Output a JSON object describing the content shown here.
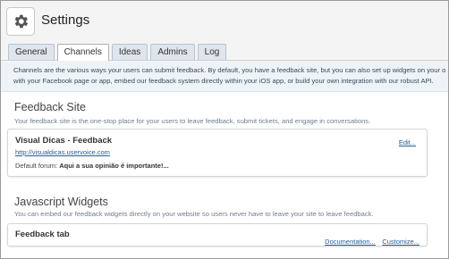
{
  "header": {
    "title": "Settings",
    "icon": "gear-icon"
  },
  "tabs": [
    {
      "label": "General",
      "active": false
    },
    {
      "label": "Channels",
      "active": true
    },
    {
      "label": "Ideas",
      "active": false
    },
    {
      "label": "Admins",
      "active": false
    },
    {
      "label": "Log",
      "active": false
    }
  ],
  "intro": {
    "line1": "Channels are the various ways your users can submit feedback. By default, you have a feedback site, but you can also set up widgets on your o",
    "line2": "with your Facebook page or app, embed our feedback system directly within your iOS app, or build your own integration with our robust API."
  },
  "feedback_site": {
    "title": "Feedback Site",
    "description": "Your feedback site is the one-stop place for your users to leave feedback, submit tickets, and engage in conversations.",
    "card": {
      "name": "Visual Dicas - Feedback",
      "url": "http://visualdicas.uservoice.com",
      "forum_label": "Default forum:",
      "forum_value": "Aqui a sua opinião é importante!...",
      "edit_link": "Edit..."
    }
  },
  "widgets": {
    "title": "Javascript Widgets",
    "description": "You can embed our feedback widgets directly on your website so users never have to leave your site to leave feedback.",
    "card": {
      "name": "Feedback tab",
      "documentation_link": "Documentation...",
      "customize_link": "Customize..."
    }
  }
}
